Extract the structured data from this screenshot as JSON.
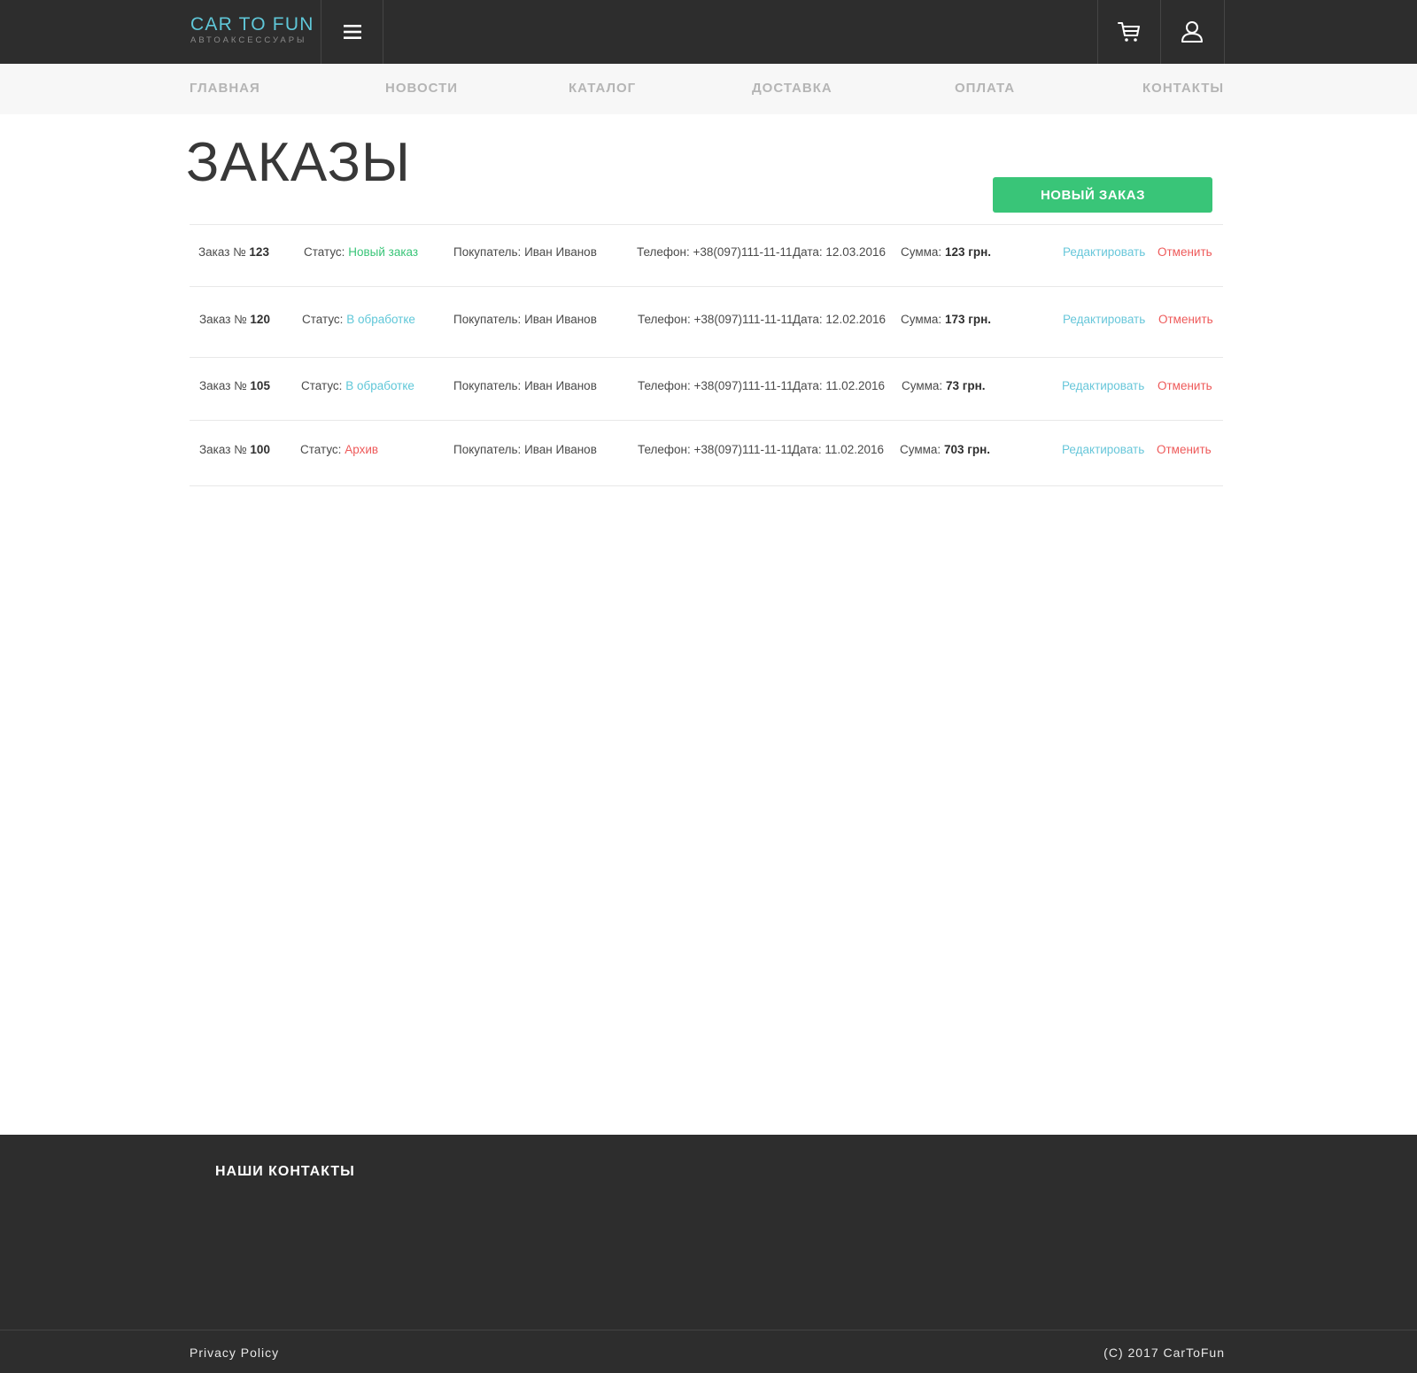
{
  "brand": {
    "title": "CAR TO FUN",
    "subtitle": "АВТОАКСЕССУАРЫ"
  },
  "header": {
    "menu_icon": "hamburger-icon",
    "cart_icon": "cart-icon",
    "user_icon": "user-icon"
  },
  "nav": {
    "items": [
      {
        "label": "ГЛАВНАЯ"
      },
      {
        "label": "НОВОСТИ"
      },
      {
        "label": "КАТАЛОГ"
      },
      {
        "label": "ДОСТАВКА"
      },
      {
        "label": "ОПЛАТА"
      },
      {
        "label": "КОНТАКТЫ"
      }
    ]
  },
  "page": {
    "title": "ЗАКАЗЫ",
    "new_order_label": "НОВЫЙ ЗАКАЗ"
  },
  "labels": {
    "order": "Заказ №",
    "status": "Статус:",
    "buyer": "Покупатель:",
    "phone": "Телефон:",
    "date": "Дата:",
    "sum": "Сумма:",
    "edit": "Редактировать",
    "cancel": "Отменить"
  },
  "orders": [
    {
      "number": "123",
      "status": "Новый заказ",
      "buyer": "Иван Иванов",
      "phone": "+38(097)111-11-11",
      "date": "12.03.2016",
      "sum": "123 грн."
    },
    {
      "number": "120",
      "status": "В обработке",
      "buyer": "Иван Иванов",
      "phone": "+38(097)111-11-11",
      "date": "12.02.2016",
      "sum": "173 грн."
    },
    {
      "number": "105",
      "status": "В обработке",
      "buyer": "Иван Иванов",
      "phone": "+38(097)111-11-11",
      "date": "11.02.2016",
      "sum": "73 грн."
    },
    {
      "number": "100",
      "status": "Архив",
      "buyer": "Иван Иванов",
      "phone": "+38(097)111-11-11",
      "date": "11.02.2016",
      "sum": "703 грн."
    }
  ],
  "colors": {
    "accent": "#5fc7d8",
    "status_new": "#39c578",
    "status_processing": "#5fc7d8",
    "status_archive": "#ee5a5a",
    "button": "#39c578",
    "dark": "#2d2d2d"
  },
  "footer": {
    "heading": "НАШИ КОНТАКТЫ",
    "privacy": "Privacy Policy",
    "copyright": "(C) 2017 CarToFun"
  }
}
